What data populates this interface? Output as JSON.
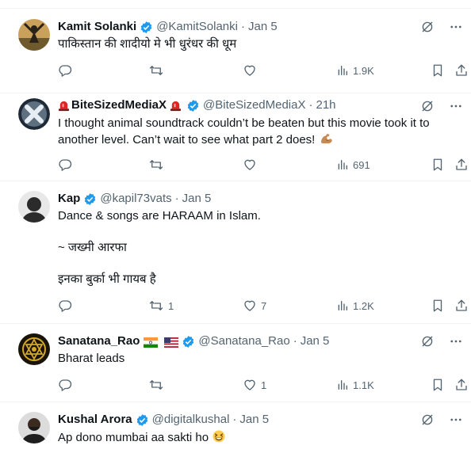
{
  "colors": {
    "accent": "#1d9bf0",
    "secondary_text": "#536471",
    "primary_text": "#0f1419",
    "divider": "#eff3f4"
  },
  "tweets": [
    {
      "name": "Kamit Solanki",
      "handle": "@KamitSolanki",
      "sep": "·",
      "time": "Jan 5",
      "text": [
        "पाकिस्तान की शादीयो मे भी धुरंधर की धूम"
      ],
      "counts": {
        "replies": "",
        "retweets": "",
        "likes": "",
        "views": "1.9K"
      }
    },
    {
      "name": "BiteSizedMediaX",
      "handle": "@BiteSizedMediaX",
      "sep": "·",
      "time": "21h",
      "text": [
        "I thought animal soundtrack couldn’t be beaten but this movie took it to",
        "another level. Can’t wait to see what part 2 does!"
      ],
      "emoji": "flexed-biceps",
      "counts": {
        "replies": "",
        "retweets": "",
        "likes": "",
        "views": "691"
      }
    },
    {
      "name": "Kap",
      "handle": "@kapil73vats",
      "sep": "·",
      "time": "Jan 5",
      "text": [
        "Dance & songs are HARAAM in Islam.",
        "~ जख्मी आरफा",
        "इनका बुर्का भी गायब है"
      ],
      "counts": {
        "replies": "",
        "retweets": "1",
        "likes": "7",
        "views": "1.2K"
      }
    },
    {
      "name": "Sanatana_Rao",
      "handle": "@Sanatana_Rao",
      "sep": "·",
      "time": "Jan 5",
      "flags": [
        "india-flag",
        "usa-flag"
      ],
      "text": [
        "Bharat leads"
      ],
      "counts": {
        "replies": "",
        "retweets": "",
        "likes": "1",
        "views": "1.1K"
      }
    },
    {
      "name": "Kushal Arora",
      "handle": "@digitalkushal",
      "sep": "·",
      "time": "Jan 5",
      "text": [
        "Ap dono mumbai aa sakti ho"
      ],
      "emoji": "grinning-squinting-face"
    }
  ]
}
